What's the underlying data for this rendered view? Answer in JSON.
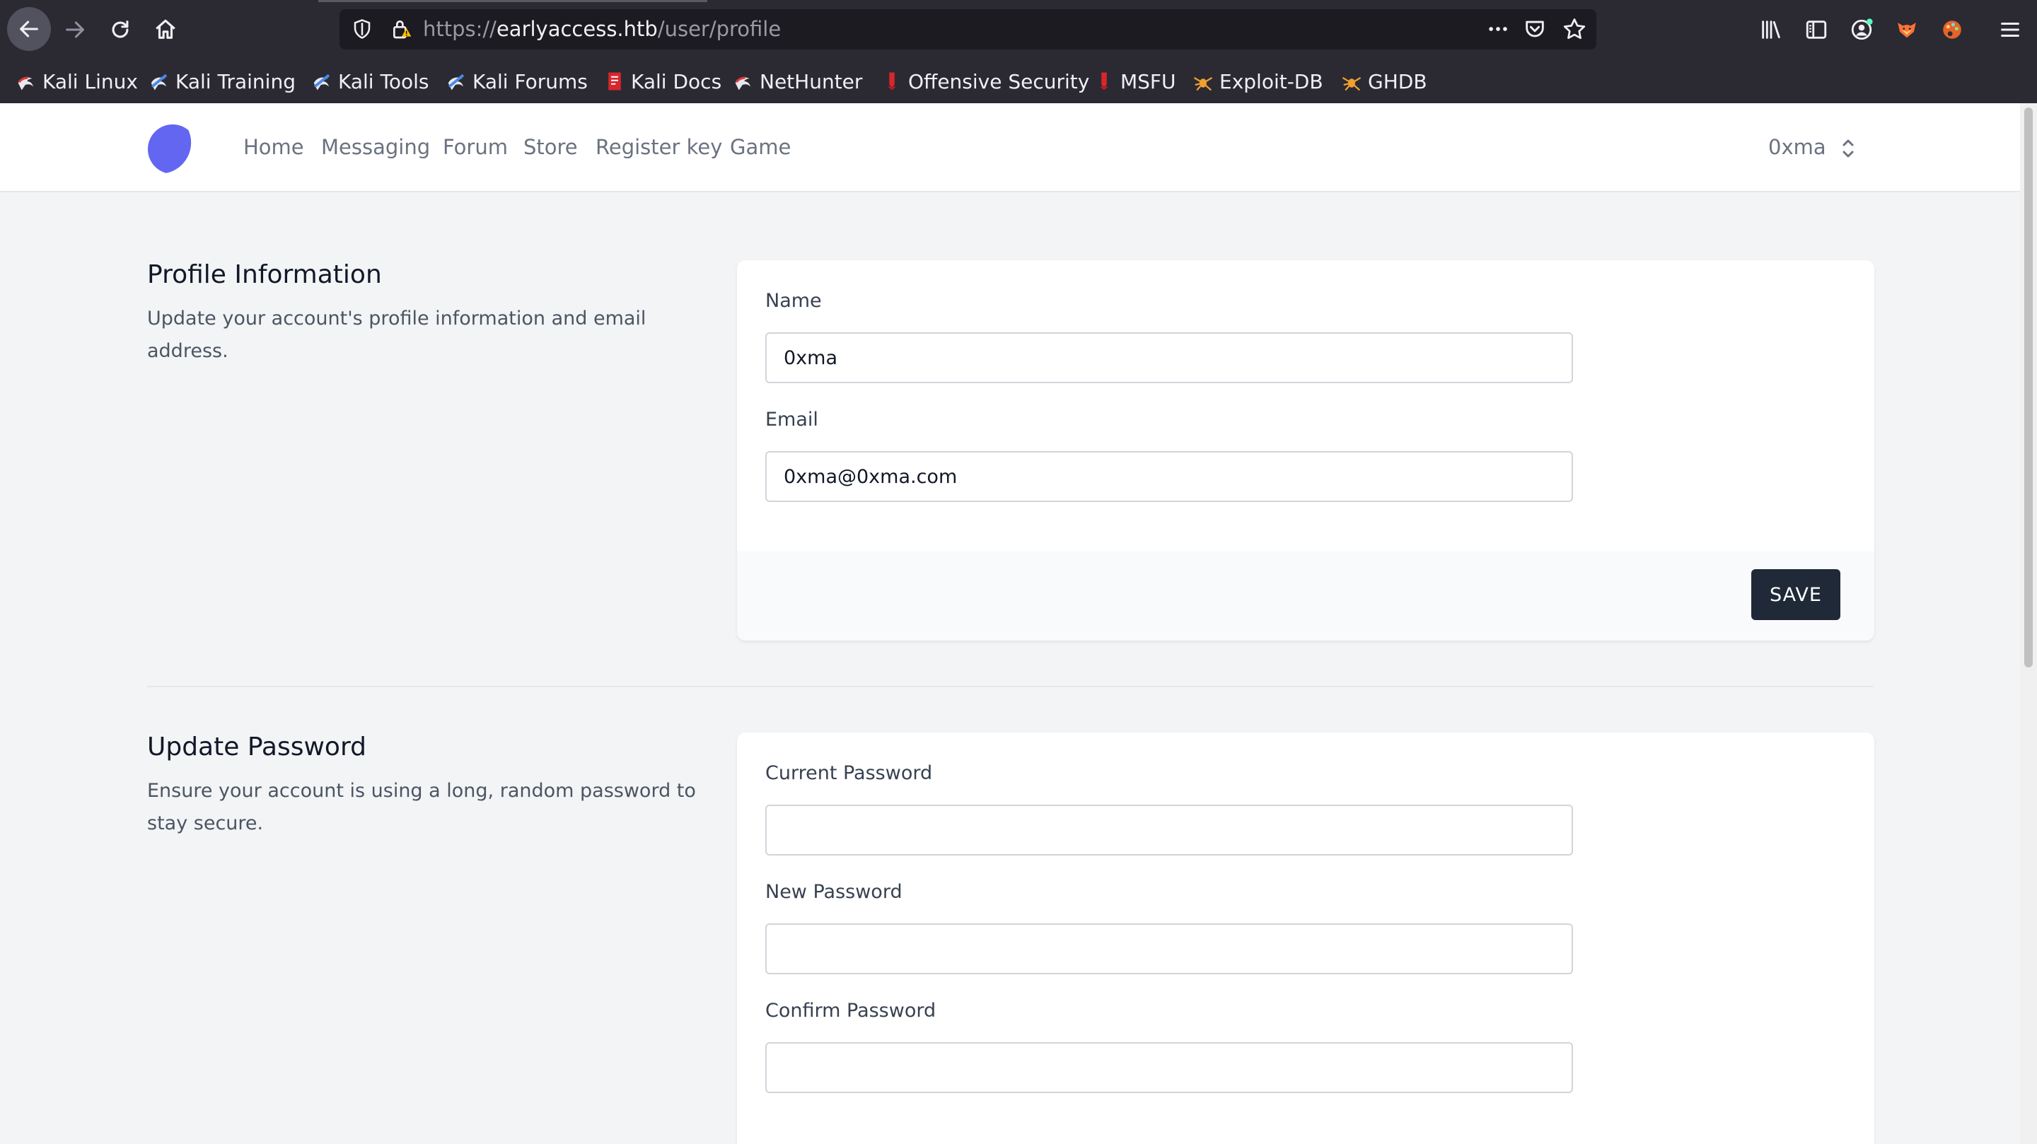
{
  "browser": {
    "url_scheme": "https://",
    "url_host": "earlyaccess.htb",
    "url_path": "/user/profile",
    "bookmarks": [
      "Kali Linux",
      "Kali Training",
      "Kali Tools",
      "Kali Forums",
      "Kali Docs",
      "NetHunter",
      "Offensive Security",
      "MSFU",
      "Exploit-DB",
      "GHDB"
    ]
  },
  "nav": {
    "links": [
      "Home",
      "Messaging",
      "Forum",
      "Store",
      "Register key",
      "Game"
    ],
    "user": "0xma"
  },
  "profile": {
    "title": "Profile Information",
    "description": "Update your account's profile information and email address.",
    "name_label": "Name",
    "name_value": "0xma",
    "email_label": "Email",
    "email_value": "0xma@0xma.com",
    "save_label": "SAVE"
  },
  "password": {
    "title": "Update Password",
    "description": "Ensure your account is using a long, random password to stay secure.",
    "current_label": "Current Password",
    "new_label": "New Password",
    "confirm_label": "Confirm Password"
  },
  "colors": {
    "chrome_bg": "#2b2a33",
    "urlbar_bg": "#1c1b22",
    "page_bg": "#f3f4f6",
    "logo_accent": "#6366f1",
    "save_button_bg": "#1f2937"
  }
}
